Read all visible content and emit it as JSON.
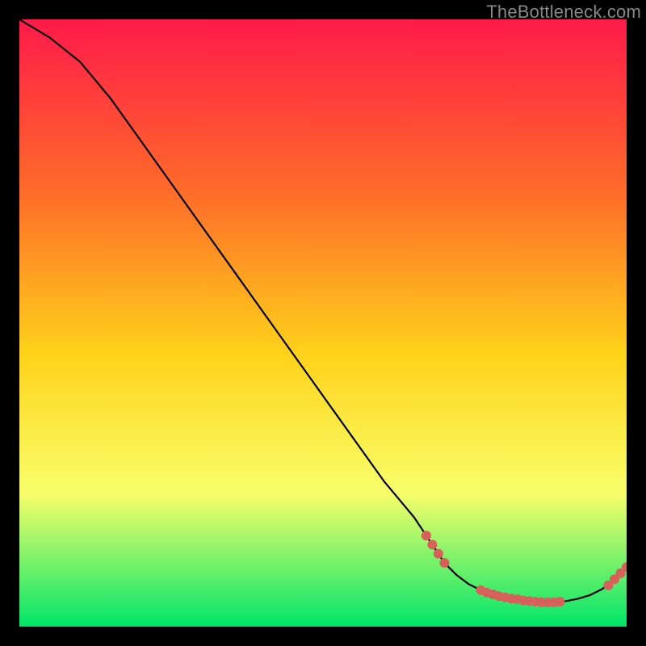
{
  "watermark": "TheBottleneck.com",
  "colors": {
    "gradient_top": "#ff1a4a",
    "gradient_upper": "#ff6a2a",
    "gradient_mid": "#ffd21a",
    "gradient_lower": "#f8ff6a",
    "gradient_bottom": "#00e56a",
    "curve": "#000000",
    "marker": "#d6605a",
    "background": "#000000"
  },
  "chart_data": {
    "type": "line",
    "title": "",
    "xlabel": "",
    "ylabel": "",
    "xlim": [
      0,
      100
    ],
    "ylim": [
      0,
      100
    ],
    "curve": {
      "x": [
        0,
        5,
        10,
        15,
        20,
        25,
        30,
        35,
        40,
        45,
        50,
        55,
        60,
        65,
        67,
        70,
        72,
        74,
        76,
        78,
        80,
        82,
        84,
        86,
        88,
        90,
        92,
        94,
        96,
        98,
        100
      ],
      "y": [
        100,
        97,
        93,
        87,
        80,
        73,
        66,
        59,
        52,
        45,
        38,
        31,
        24,
        18,
        15,
        10.5,
        8.5,
        7,
        6,
        5.3,
        4.8,
        4.5,
        4.2,
        4.0,
        4.0,
        4.2,
        4.6,
        5.2,
        6.2,
        7.8,
        9.8
      ]
    },
    "markers": [
      {
        "x": 67,
        "y": 15
      },
      {
        "x": 68,
        "y": 13.5
      },
      {
        "x": 69,
        "y": 12
      },
      {
        "x": 70,
        "y": 10.5
      },
      {
        "x": 76,
        "y": 6
      },
      {
        "x": 77,
        "y": 5.6
      },
      {
        "x": 78,
        "y": 5.3
      },
      {
        "x": 79,
        "y": 5.0
      },
      {
        "x": 80,
        "y": 4.8
      },
      {
        "x": 81,
        "y": 4.6
      },
      {
        "x": 82,
        "y": 4.5
      },
      {
        "x": 83,
        "y": 4.3
      },
      {
        "x": 84,
        "y": 4.2
      },
      {
        "x": 85,
        "y": 4.1
      },
      {
        "x": 86,
        "y": 4.0
      },
      {
        "x": 87,
        "y": 4.0
      },
      {
        "x": 88,
        "y": 4.0
      },
      {
        "x": 89,
        "y": 4.1
      },
      {
        "x": 97,
        "y": 6.8
      },
      {
        "x": 98,
        "y": 7.8
      },
      {
        "x": 99,
        "y": 8.8
      },
      {
        "x": 100,
        "y": 9.8
      }
    ]
  }
}
